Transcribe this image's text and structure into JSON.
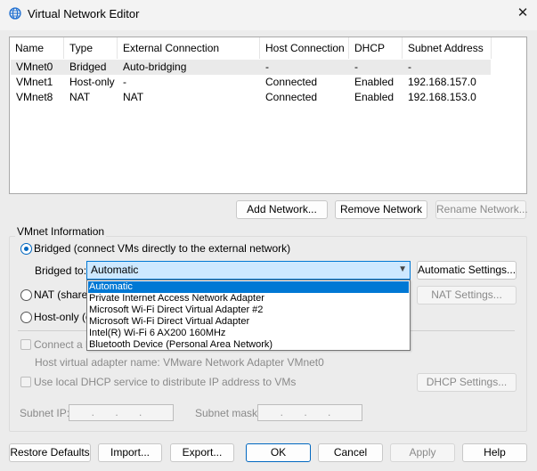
{
  "window": {
    "title": "Virtual Network Editor",
    "close_glyph": "✕",
    "icon": "globe-icon"
  },
  "table": {
    "headers": [
      "Name",
      "Type",
      "External Connection",
      "Host Connection",
      "DHCP",
      "Subnet Address"
    ],
    "rows": [
      [
        "VMnet0",
        "Bridged",
        "Auto-bridging",
        "-",
        "-",
        "-"
      ],
      [
        "VMnet1",
        "Host-only",
        "-",
        "Connected",
        "Enabled",
        "192.168.157.0"
      ],
      [
        "VMnet8",
        "NAT",
        "NAT",
        "Connected",
        "Enabled",
        "192.168.153.0"
      ]
    ]
  },
  "network_buttons": {
    "add": "Add Network...",
    "remove": "Remove Network",
    "rename": "Rename Network..."
  },
  "vmnet_info": {
    "group_title": "VMnet Information",
    "bridged_label": "Bridged (connect VMs directly to the external network)",
    "bridged_to_label": "Bridged to:",
    "bridged_to_value": "Automatic",
    "automatic_settings": "Automatic Settings...",
    "nat_label": "NAT (shared",
    "nat_settings": "NAT Settings...",
    "hostonly_label": "Host-only (c",
    "connect_host_label": "Connect a h",
    "host_adapter_name": "Host virtual adapter name: VMware Network Adapter VMnet0",
    "dhcp_label": "Use local DHCP service to distribute IP address to VMs",
    "dhcp_settings": "DHCP Settings...",
    "subnet_ip_label": "Subnet IP:",
    "subnet_ip_value": ". . .",
    "subnet_mask_label": "Subnet mask:",
    "subnet_mask_value": ". . .",
    "selected_mode": "Bridged"
  },
  "dropdown_options": [
    "Automatic",
    "Private Internet Access Network Adapter",
    "Microsoft Wi-Fi Direct Virtual Adapter #2",
    "Microsoft Wi-Fi Direct Virtual Adapter",
    "Intel(R) Wi-Fi 6 AX200 160MHz",
    "Bluetooth Device (Personal Area Network)"
  ],
  "dropdown_highlighted": "Automatic",
  "footer_buttons": {
    "restore": "Restore Defaults",
    "import": "Import...",
    "export": "Export...",
    "ok": "OK",
    "cancel": "Cancel",
    "apply": "Apply",
    "help": "Help"
  },
  "colors": {
    "accent": "#0078d4",
    "selection": "#cde8ff",
    "row_selected": "#eaeaea"
  }
}
